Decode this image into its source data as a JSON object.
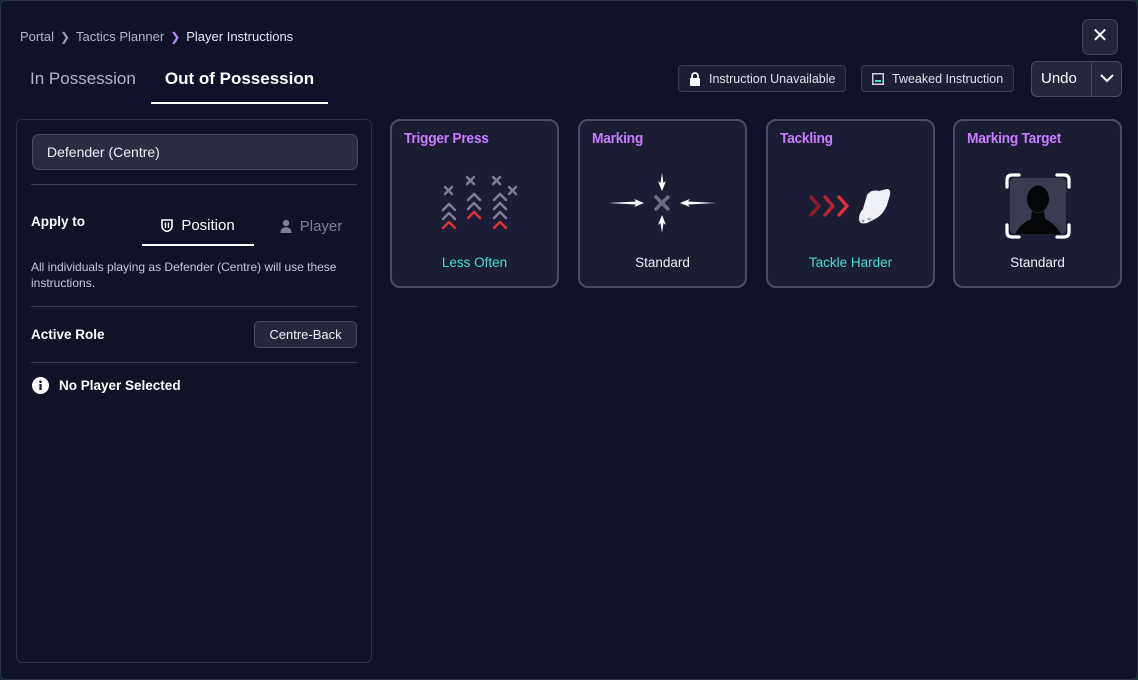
{
  "breadcrumb": [
    "Portal",
    "Tactics Planner",
    "Player Instructions"
  ],
  "tabs": [
    "In Possession",
    "Out of Possession"
  ],
  "active_tab": "Out of Possession",
  "legend": {
    "unavailable": "Instruction Unavailable",
    "tweaked": "Tweaked Instruction"
  },
  "undo_label": "Undo",
  "left": {
    "position": "Defender (Centre)",
    "apply_to_label": "Apply to",
    "apply_options": [
      "Position",
      "Player"
    ],
    "apply_selected": "Position",
    "help_text": "All individuals playing as Defender (Centre) will use these instructions.",
    "active_role_label": "Active Role",
    "active_role_value": "Centre-Back",
    "no_player": "No Player Selected"
  },
  "cards": [
    {
      "title": "Trigger Press",
      "value": "Less Often",
      "icon": "press-chevrons-icon",
      "value_color": "#3fe0d0"
    },
    {
      "title": "Marking",
      "value": "Standard",
      "icon": "marking-arrows-icon",
      "value_color": "#f0f1f6"
    },
    {
      "title": "Tackling",
      "value": "Tackle Harder",
      "icon": "boot-tackle-icon",
      "value_color": "#3fe0d0"
    },
    {
      "title": "Marking Target",
      "value": "Standard",
      "icon": "player-silhouette-icon",
      "value_color": "#f0f1f6"
    }
  ],
  "colors": {
    "accent_purple": "#c97cff",
    "accent_teal": "#3fe0d0",
    "accent_red": "#e0303a",
    "background": "#10112a"
  }
}
